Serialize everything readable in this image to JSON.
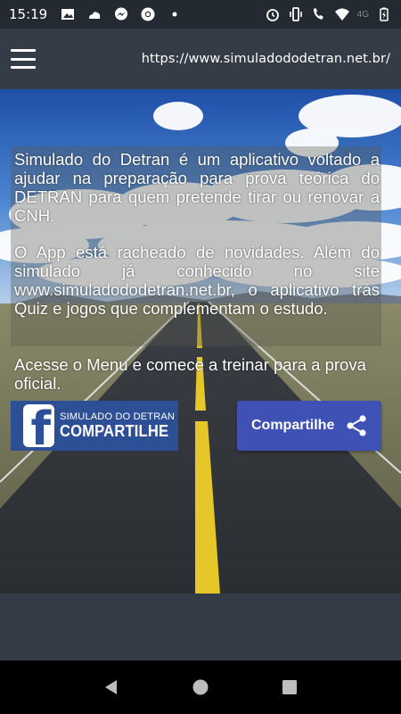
{
  "status_bar": {
    "time": "15:19",
    "left_icons": [
      "image-icon",
      "cloud-fire-icon",
      "messenger-icon",
      "chrome-icon",
      "dot-icon"
    ],
    "right_icons": [
      "alarm-icon",
      "vibrate-icon",
      "wifi-calling-icon",
      "wifi-icon",
      "signal-4g-icon",
      "battery-icon"
    ],
    "network": "4G"
  },
  "app_bar": {
    "menu_icon": "hamburger-menu-icon",
    "url": "https://www.simuladododetran.net.br/"
  },
  "content": {
    "paragraph_1": "Simulado do Detran é um aplicativo voltado a ajudar na preparação para prova teórica do DETRAN para quem pretende tirar ou renovar a CNH.",
    "paragraph_2": "O App está racheado de novidades. Além do simulado já conhecido no site www.simuladododetran.net.br, o aplicativo trás Quiz e jogos que complementam o estudo.",
    "paragraph_3": "Acesse o Menu e comece a treinar para a prova oficial."
  },
  "buttons": {
    "facebook_top": "SIMULADO DO DETRAN",
    "facebook_bottom": "COMPARTILHE",
    "share_label": "Compartilhe"
  },
  "colors": {
    "app_bar": "#343c47",
    "facebook": "#2d4f96",
    "share_button": "#3f51b5"
  }
}
